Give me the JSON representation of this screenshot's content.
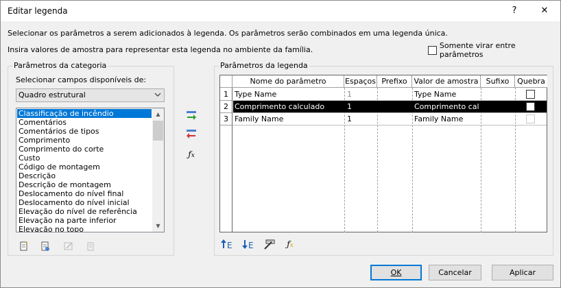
{
  "window": {
    "title": "Editar legenda",
    "help_glyph": "?",
    "close_glyph": "✕"
  },
  "description": {
    "line1": "Selecionar os parâmetros a serem adicionados à legenda. Os parâmetros serão combinados em uma legenda única.",
    "line2": "Insira valores de amostra para representar esta legenda no ambiente da família."
  },
  "options": {
    "only_rotate_label": "Somente virar entre parâmetros",
    "only_rotate_checked": false
  },
  "category_params": {
    "group_title": "Parâmetros da categoria",
    "select_fields_label": "Selecionar campos disponíveis de:",
    "combo_value": "Quadro estrutural",
    "fields": [
      "Classificação de incêndio",
      "Comentários",
      "Comentários de tipos",
      "Comprimento",
      "Comprimento do corte",
      "Custo",
      "Código de montagem",
      "Descrição",
      "Descrição de montagem",
      "Deslocamento do nível final",
      "Deslocamento do nível inicial",
      "Elevação do nível de referência",
      "Elevação na parte inferior",
      "Elevação no topo"
    ],
    "selected_index": 0
  },
  "legend_params": {
    "group_title": "Parâmetros da legenda",
    "columns": [
      "Nome do parâmetro",
      "Espaços",
      "Prefixo",
      "Valor de amostra",
      "Sufixo",
      "Quebra"
    ],
    "rows": [
      {
        "num": "1",
        "name": "Type Name",
        "spaces": "1",
        "prefix": "",
        "sample": "Type Name",
        "suffix": "",
        "selected": false,
        "break_enabled": true
      },
      {
        "num": "2",
        "name": "Comprimento calculado",
        "spaces": "1",
        "prefix": "",
        "sample": "Comprimento cal",
        "suffix": "",
        "selected": true,
        "break_enabled": true
      },
      {
        "num": "3",
        "name": "Family Name",
        "spaces": "1",
        "prefix": "",
        "sample": "Family Name",
        "suffix": "",
        "selected": false,
        "break_enabled": false
      }
    ]
  },
  "icons": {
    "add_param": "add-parameter-icon",
    "remove_param": "remove-parameter-icon",
    "fx": "fx-icon",
    "new_param": "new-parameter-icon",
    "edit_param": "edit-parameter-icon",
    "delete_param": "delete-parameter-icon",
    "move_up": "move-up-icon",
    "move_down": "move-down-icon",
    "edit_format": "edit-format-icon",
    "edit_formula": "edit-formula-icon"
  },
  "buttons": {
    "ok": "OK",
    "cancel": "Cancelar",
    "apply": "Aplicar"
  },
  "colors": {
    "selection_blue": "#0078d7",
    "arrow_green": "#2a9d2a",
    "arrow_red": "#d32f2f"
  }
}
